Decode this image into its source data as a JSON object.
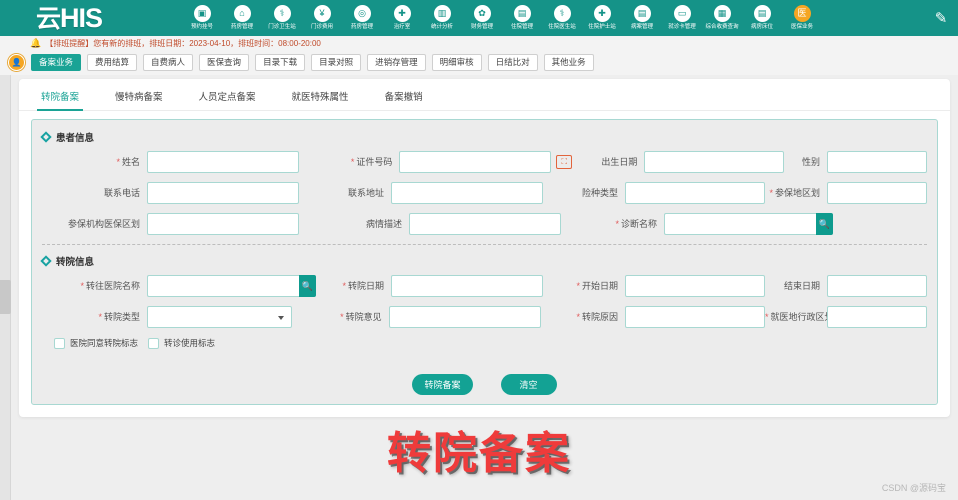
{
  "header": {
    "logo_cn": "云",
    "logo_en": "HIS",
    "nav_items": [
      {
        "label": "预约挂号",
        "icon": "calendar-icon",
        "glyph": "▣"
      },
      {
        "label": "药房管理",
        "icon": "pharmacy-icon",
        "glyph": "⌂"
      },
      {
        "label": "门诊卫生站",
        "icon": "clinic-station-icon",
        "glyph": "⚕"
      },
      {
        "label": "门诊费用",
        "icon": "outpatient-fee-icon",
        "glyph": "¥"
      },
      {
        "label": "药房管理",
        "icon": "drug-store-icon",
        "glyph": "◎"
      },
      {
        "label": "治疗室",
        "icon": "treatment-room-icon",
        "glyph": "✚"
      },
      {
        "label": "统计分析",
        "icon": "statistics-icon",
        "glyph": "▥"
      },
      {
        "label": "财务管理",
        "icon": "finance-icon",
        "glyph": "✿"
      },
      {
        "label": "住院管理",
        "icon": "inpatient-icon",
        "glyph": "▤"
      },
      {
        "label": "住院医生站",
        "icon": "doctor-station-icon",
        "glyph": "⚕"
      },
      {
        "label": "住院护士站",
        "icon": "nurse-station-icon",
        "glyph": "✚"
      },
      {
        "label": "病案管理",
        "icon": "medical-record-icon",
        "glyph": "▤"
      },
      {
        "label": "就诊卡管理",
        "icon": "card-manage-icon",
        "glyph": "▭"
      },
      {
        "label": "综合收费查询",
        "icon": "fee-query-icon",
        "glyph": "▦"
      },
      {
        "label": "病房床位",
        "icon": "ward-bed-icon",
        "glyph": "▤"
      },
      {
        "label": "医保业务",
        "icon": "insurance-icon",
        "glyph": "医"
      }
    ],
    "edit_icon": "pencil-icon"
  },
  "notice": {
    "bell_icon": "bell-icon",
    "text": "【排班提醒】您有新的排班，排班日期：2023-04-10，排班时间：08:00-20:00"
  },
  "toolbar": {
    "avatar_icon": "user-avatar",
    "buttons": [
      {
        "label": "备案业务",
        "active": true
      },
      {
        "label": "费用结算",
        "active": false
      },
      {
        "label": "自费病人",
        "active": false
      },
      {
        "label": "医保查询",
        "active": false
      },
      {
        "label": "目录下载",
        "active": false
      },
      {
        "label": "目录对照",
        "active": false
      },
      {
        "label": "进销存管理",
        "active": false
      },
      {
        "label": "明细审核",
        "active": false
      },
      {
        "label": "日结比对",
        "active": false
      },
      {
        "label": "其他业务",
        "active": false
      }
    ]
  },
  "tabs": [
    {
      "label": "转院备案",
      "active": true
    },
    {
      "label": "慢特病备案",
      "active": false
    },
    {
      "label": "人员定点备案",
      "active": false
    },
    {
      "label": "就医特殊属性",
      "active": false
    },
    {
      "label": "备案撤销",
      "active": false
    }
  ],
  "patient_section": {
    "title": "患者信息",
    "fields": {
      "name": {
        "label": "姓名",
        "required": true,
        "value": ""
      },
      "id_number": {
        "label": "证件号码",
        "required": true,
        "value": "",
        "scan_icon": "scan-icon"
      },
      "birth_date": {
        "label": "出生日期",
        "required": false,
        "value": ""
      },
      "gender": {
        "label": "性别",
        "required": false,
        "value": ""
      },
      "phone": {
        "label": "联系电话",
        "required": false,
        "value": ""
      },
      "address": {
        "label": "联系地址",
        "required": false,
        "value": ""
      },
      "insurance_type": {
        "label": "险种类型",
        "required": false,
        "value": ""
      },
      "insured_area": {
        "label": "参保地区划",
        "required": true,
        "value": ""
      },
      "insurer_area_code": {
        "label": "参保机构医保区划",
        "required": false,
        "value": ""
      },
      "illness_desc": {
        "label": "病情描述",
        "required": false,
        "value": ""
      },
      "diagnosis": {
        "label": "诊断名称",
        "required": true,
        "value": "",
        "search_icon": "search-icon"
      }
    }
  },
  "transfer_section": {
    "title": "转院信息",
    "fields": {
      "target_hospital": {
        "label": "转往医院名称",
        "required": true,
        "value": "",
        "search_icon": "search-icon"
      },
      "transfer_date": {
        "label": "转院日期",
        "required": true,
        "value": ""
      },
      "start_date": {
        "label": "开始日期",
        "required": true,
        "value": ""
      },
      "end_date": {
        "label": "结束日期",
        "required": false,
        "value": ""
      },
      "transfer_type": {
        "label": "转院类型",
        "required": true,
        "value": "",
        "is_select": true
      },
      "transfer_opinion": {
        "label": "转院意见",
        "required": true,
        "value": ""
      },
      "transfer_reason": {
        "label": "转院原因",
        "required": true,
        "value": ""
      },
      "treat_area": {
        "label": "就医地行政区划",
        "required": true,
        "value": ""
      }
    },
    "checkboxes": [
      {
        "label": "医院同意转院标志",
        "checked": false
      },
      {
        "label": "转诊使用标志",
        "checked": false
      }
    ]
  },
  "actions": [
    {
      "label": "转院备案"
    },
    {
      "label": "清空"
    }
  ],
  "watermark": {
    "title": "转院备案",
    "credit": "CSDN @源码宝"
  },
  "colors": {
    "header_teal": "#159388",
    "accent_teal": "#1aa395",
    "border_teal": "#a8d8d2",
    "orange": "#f5a623",
    "required_red": "#e05a5a",
    "watermark_red": "#ef3b3b"
  }
}
